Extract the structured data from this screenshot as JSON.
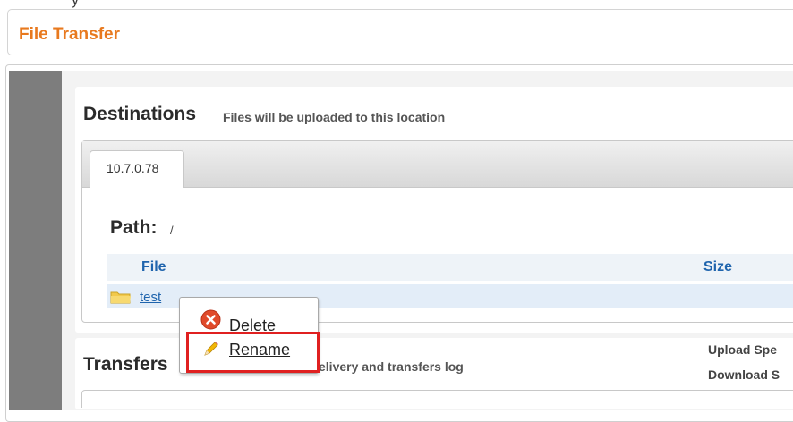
{
  "header": {
    "title": "File Transfer"
  },
  "top_clipped_text": "y",
  "destinations": {
    "title": "Destinations",
    "subtitle": "Files will be uploaded to this location",
    "tab_label": "10.7.0.78",
    "path_label": "Path:",
    "path_value": "/",
    "columns": {
      "file": "File",
      "size": "Size"
    },
    "files": [
      {
        "name": "test",
        "type": "folder"
      }
    ]
  },
  "context_menu": {
    "items": [
      {
        "label": "Delete",
        "icon": "delete-icon"
      },
      {
        "label": "Rename",
        "icon": "pencil-icon"
      }
    ]
  },
  "transfers": {
    "title": "Transfers",
    "subtitle": "elivery and transfers log",
    "upload_speed_label": "Upload Spe",
    "download_speed_label": "Download S"
  },
  "colors": {
    "accent": "#e8791e",
    "link": "#1f64ad",
    "highlight": "#e02020",
    "sidebar": "#7d7d7d"
  }
}
